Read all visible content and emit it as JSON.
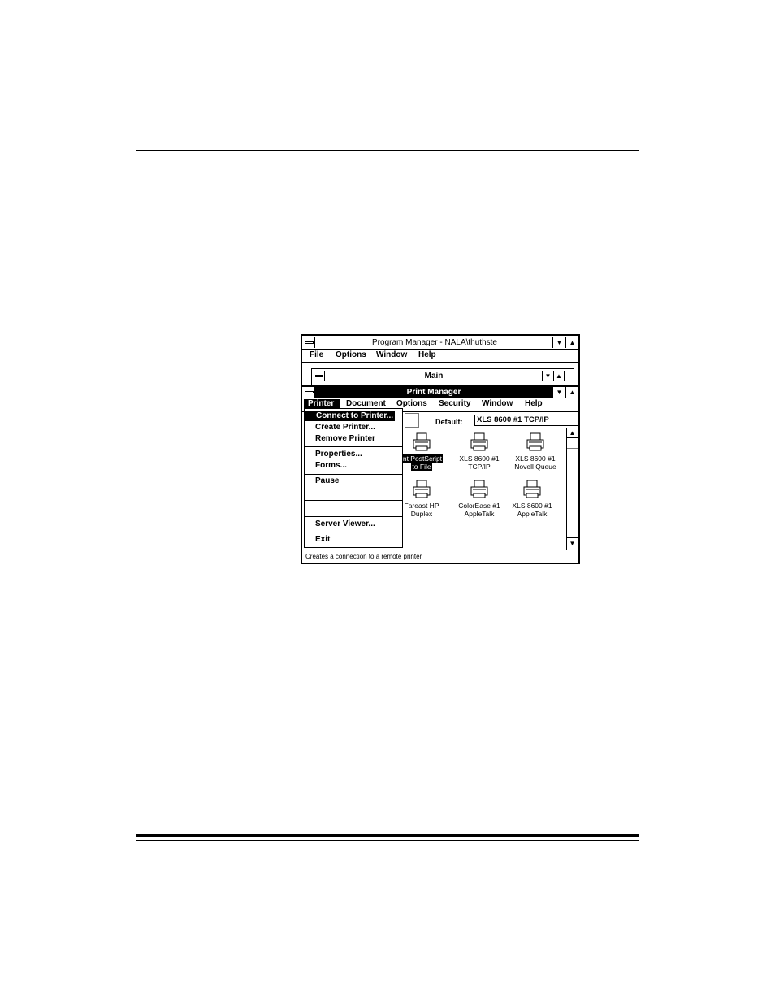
{
  "program_manager": {
    "title": "Program Manager - NALA\\thuthste",
    "menu": [
      "File",
      "Options",
      "Window",
      "Help"
    ],
    "child_title": "Main"
  },
  "print_manager": {
    "title": "Print Manager",
    "menu": [
      "Printer",
      "Document",
      "Options",
      "Security",
      "Window",
      "Help"
    ],
    "default_label": "Default:",
    "default_value": "XLS 8600 #1 TCP/IP",
    "printers": [
      {
        "line1": "int PostScript",
        "line2": "to File",
        "selected": true,
        "icon": "printer-icon"
      },
      {
        "line1": "XLS 8600 #1",
        "line2": "TCP/IP",
        "selected": false,
        "icon": "printer-icon"
      },
      {
        "line1": "XLS 8600 #1",
        "line2": "Novell Queue",
        "selected": false,
        "icon": "printer-icon"
      },
      {
        "line1": "Fareast HP",
        "line2": "Duplex",
        "selected": false,
        "icon": "printer-icon"
      },
      {
        "line1": "ColorEase #1",
        "line2": "AppleTalk",
        "selected": false,
        "icon": "printer-icon"
      },
      {
        "line1": "XLS 8600 #1",
        "line2": "AppleTalk",
        "selected": false,
        "icon": "printer-icon"
      }
    ],
    "status": "Creates a connection to a remote printer"
  },
  "printer_menu": {
    "items": [
      "Connect to Printer...",
      "Create Printer...",
      "Remove Printer",
      "Properties...",
      "Forms...",
      "Pause",
      "Server Viewer...",
      "Exit"
    ],
    "selected_index": 0
  }
}
